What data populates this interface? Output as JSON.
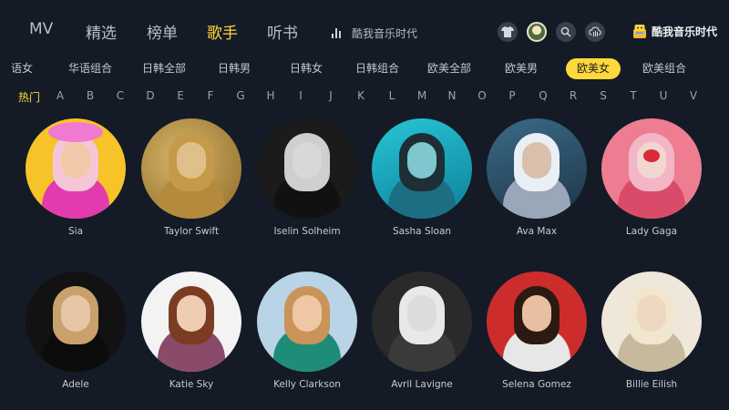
{
  "nav": {
    "tabs": [
      "MV",
      "精选",
      "榜单",
      "歌手",
      "听书"
    ],
    "active_index": 3
  },
  "now_playing": "酷我音乐时代",
  "brand": "酷我音乐时代",
  "categories": [
    "语女",
    "华语组合",
    "日韩全部",
    "日韩男",
    "日韩女",
    "日韩组合",
    "欧美全部",
    "欧美男",
    "欧美女",
    "欧美组合"
  ],
  "active_category_index": 8,
  "letters": [
    "热门",
    "A",
    "B",
    "C",
    "D",
    "E",
    "F",
    "G",
    "H",
    "I",
    "J",
    "K",
    "L",
    "M",
    "N",
    "O",
    "P",
    "Q",
    "R",
    "S",
    "T",
    "U",
    "V"
  ],
  "active_letter_index": 0,
  "artists": [
    {
      "name": "Sia"
    },
    {
      "name": "Taylor Swift"
    },
    {
      "name": "Iselin Solheim"
    },
    {
      "name": "Sasha Sloan"
    },
    {
      "name": "Ava Max"
    },
    {
      "name": "Lady Gaga"
    },
    {
      "name": "Adele"
    },
    {
      "name": "Katie Sky"
    },
    {
      "name": "Kelly Clarkson"
    },
    {
      "name": "Avril Lavigne"
    },
    {
      "name": "Selena Gomez"
    },
    {
      "name": "Billie Eilish"
    }
  ],
  "colors": {
    "background": "#141b26",
    "accent": "#ffd93b"
  },
  "icons": [
    "tshirt-icon",
    "user-avatar",
    "search-icon",
    "cloud-music-icon",
    "brand-logo-icon"
  ]
}
